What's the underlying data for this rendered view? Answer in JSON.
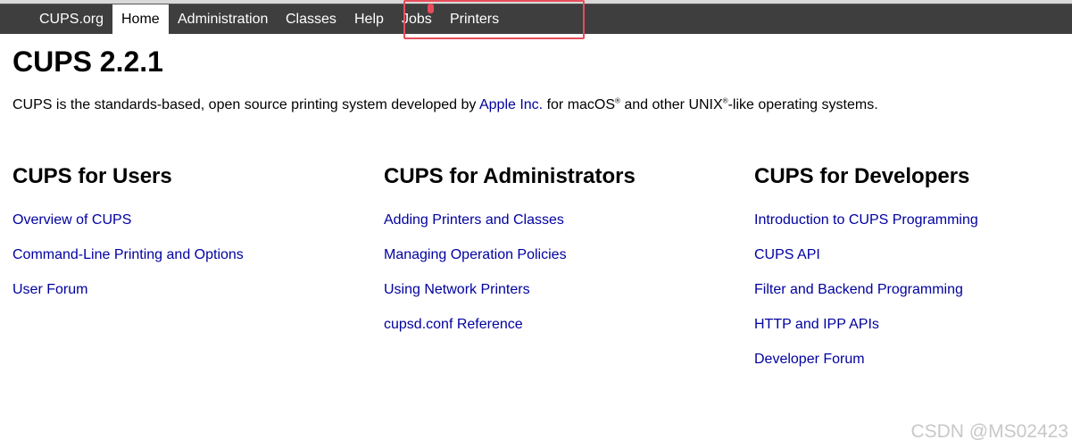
{
  "nav": {
    "items": [
      {
        "label": "CUPS.org",
        "active": false
      },
      {
        "label": "Home",
        "active": true
      },
      {
        "label": "Administration",
        "active": false
      },
      {
        "label": "Classes",
        "active": false
      },
      {
        "label": "Help",
        "active": false
      },
      {
        "label": "Jobs",
        "active": false
      },
      {
        "label": "Printers",
        "active": false
      }
    ]
  },
  "page": {
    "title": "CUPS 2.2.1",
    "intro_prefix": "CUPS is the standards-based, open source printing system developed by ",
    "intro_link": "Apple Inc.",
    "intro_mid1": " for macOS",
    "intro_reg1": "®",
    "intro_mid2": " and other UNIX",
    "intro_reg2": "®",
    "intro_suffix": "-like operating systems."
  },
  "columns": [
    {
      "heading": "CUPS for Users",
      "links": [
        "Overview of CUPS",
        "Command-Line Printing and Options",
        "User Forum"
      ]
    },
    {
      "heading": "CUPS for Administrators",
      "links": [
        "Adding Printers and Classes",
        "Managing Operation Policies",
        "Using Network Printers",
        "cupsd.conf Reference"
      ]
    },
    {
      "heading": "CUPS for Developers",
      "links": [
        "Introduction to CUPS Programming",
        "CUPS API",
        "Filter and Backend Programming",
        "HTTP and IPP APIs",
        "Developer Forum"
      ]
    }
  ],
  "watermark": "CSDN @MS02423",
  "colors": {
    "navbar_bg": "#3e3e3e",
    "link": "#0000a0",
    "highlight": "#e84c5a"
  }
}
